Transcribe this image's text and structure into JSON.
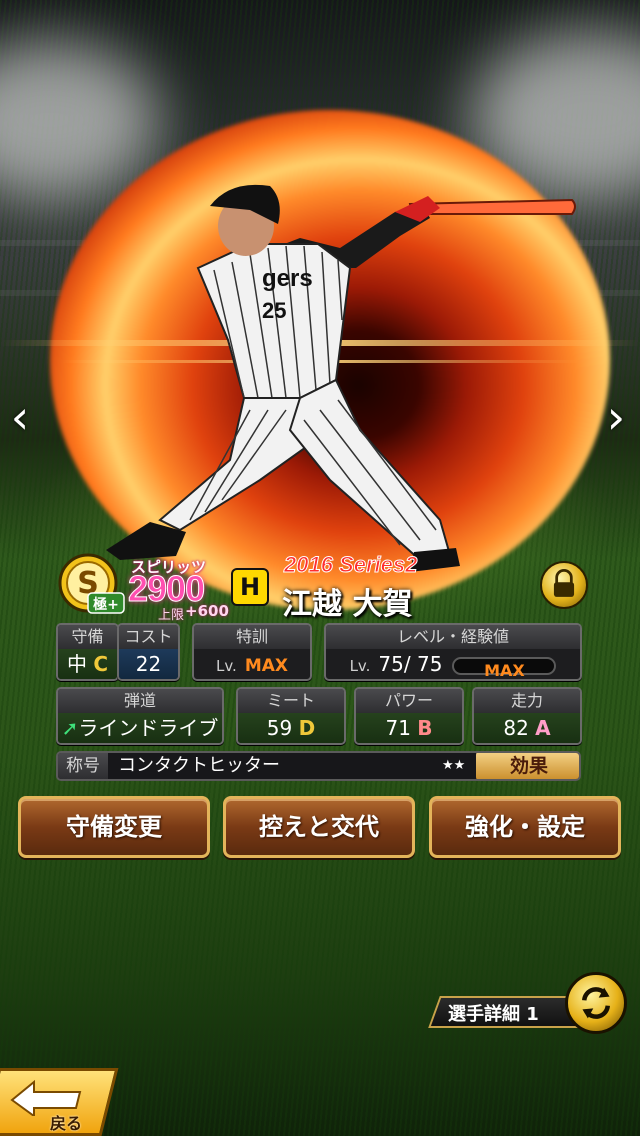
{
  "player": {
    "series": "2016 Series2",
    "name": "江越 大賀",
    "spirits_label": "スピリッツ",
    "spirits_value": "2900",
    "limit_label": "上限",
    "limit_value": "+600",
    "rank_badge": "S",
    "rank_sub": "極+",
    "team_logo": "H",
    "jersey_text": "gers",
    "jersey_number": "25"
  },
  "stats": {
    "defense": {
      "label": "守備",
      "position": "中",
      "grade": "C"
    },
    "cost": {
      "label": "コスト",
      "value": "22"
    },
    "training": {
      "label": "特訓",
      "lv_label": "Lv.",
      "value": "MAX"
    },
    "level": {
      "label": "レベル・経験値",
      "lv_label": "Lv.",
      "value": "75/ 75",
      "exp_label": "MAX",
      "exp_fraction": 1.0
    },
    "trajectory": {
      "label": "弾道",
      "value": "ラインドライブ"
    },
    "meet": {
      "label": "ミート",
      "value": "59",
      "grade": "D"
    },
    "power": {
      "label": "パワー",
      "value": "71",
      "grade": "B"
    },
    "speed": {
      "label": "走力",
      "value": "82",
      "grade": "A"
    }
  },
  "title": {
    "label": "称号",
    "value": "コンタクトヒッター",
    "stars": "★★",
    "effect_button": "効果"
  },
  "actions": {
    "change_defense": "守備変更",
    "bench_swap": "控えと交代",
    "enhance_settings": "強化・設定"
  },
  "detail": {
    "label": "選手詳細 1"
  },
  "nav": {
    "back": "戻る",
    "prev_glyph": "‹",
    "next_glyph": "›"
  },
  "colors": {
    "accent_gold": "#e3b45a",
    "spirits_pink": "#ff4fb0",
    "max_orange": "#ff8a1e"
  }
}
